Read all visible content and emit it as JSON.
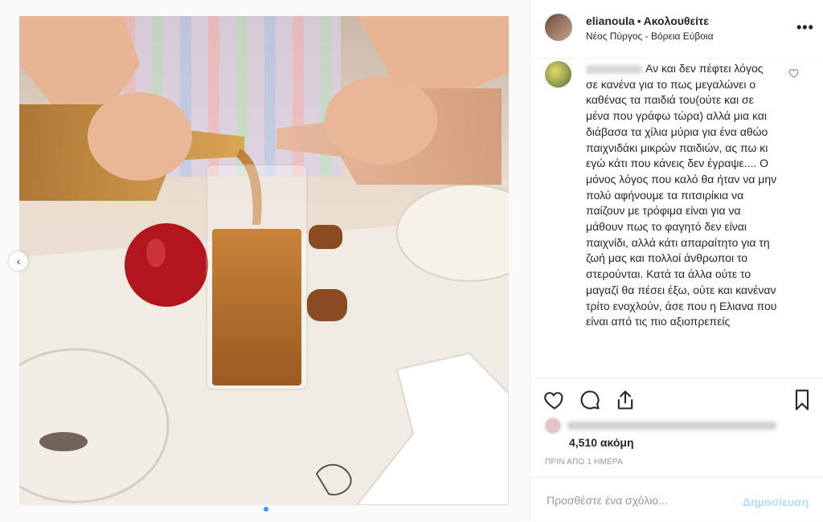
{
  "post": {
    "username": "elianoula",
    "follow_label": "Ακολουθείτε",
    "bullet": "•",
    "location": "Νέος Πύργος - Βόρεια Εύβοια",
    "more_icon": "more-dots-icon"
  },
  "comment": {
    "text": "Αν και δεν πέφτει λόγος σε κανένα για το πως μεγαλώνει ο καθένας τα παιδιά του(ούτε και σε μένα που γράφω τώρα) αλλά μια και διάβασα τα χίλια μύρια για ένα αθώο παιχνιδάκι μικρών παιδιών, ας πω κι εγώ κάτι που κάνεις δεν έγραψε.... Ο μόνος λόγος που καλό θα ήταν να μην πολύ αφήνουμε τα πιτσιρίκια να παίζουν με τρόφιμα είναι για να μάθουν πως το φαγητό δεν είναι παιχνίδι, αλλά κάτι απαραίτητο για τη ζωή μας και πολλοί άνθρωποι το στερούνται. Κατά τα άλλα ούτε το μαγαζί θα πέσει έξω, ούτε και κανέναν τρίτο ενοχλούν, άσε που η Ελιανα που είναι από τις πιο αξιοπρεπείς"
  },
  "likes": {
    "count": "4,510 ακόμη"
  },
  "timestamp": "ΠΡΙΝ ΑΠΟ 1 ΗΜΕΡΑ",
  "add_comment": {
    "placeholder": "Προσθέστε ένα σχόλιο...",
    "post_label": "Δημοσίευση"
  },
  "icons": [
    "heart-icon",
    "comment-icon",
    "share-icon",
    "bookmark-icon",
    "chevron-left-icon"
  ],
  "colors": {
    "accent": "#3897f0",
    "post_disabled": "#b3dbff",
    "border": "#efefef",
    "muted": "#999999"
  }
}
